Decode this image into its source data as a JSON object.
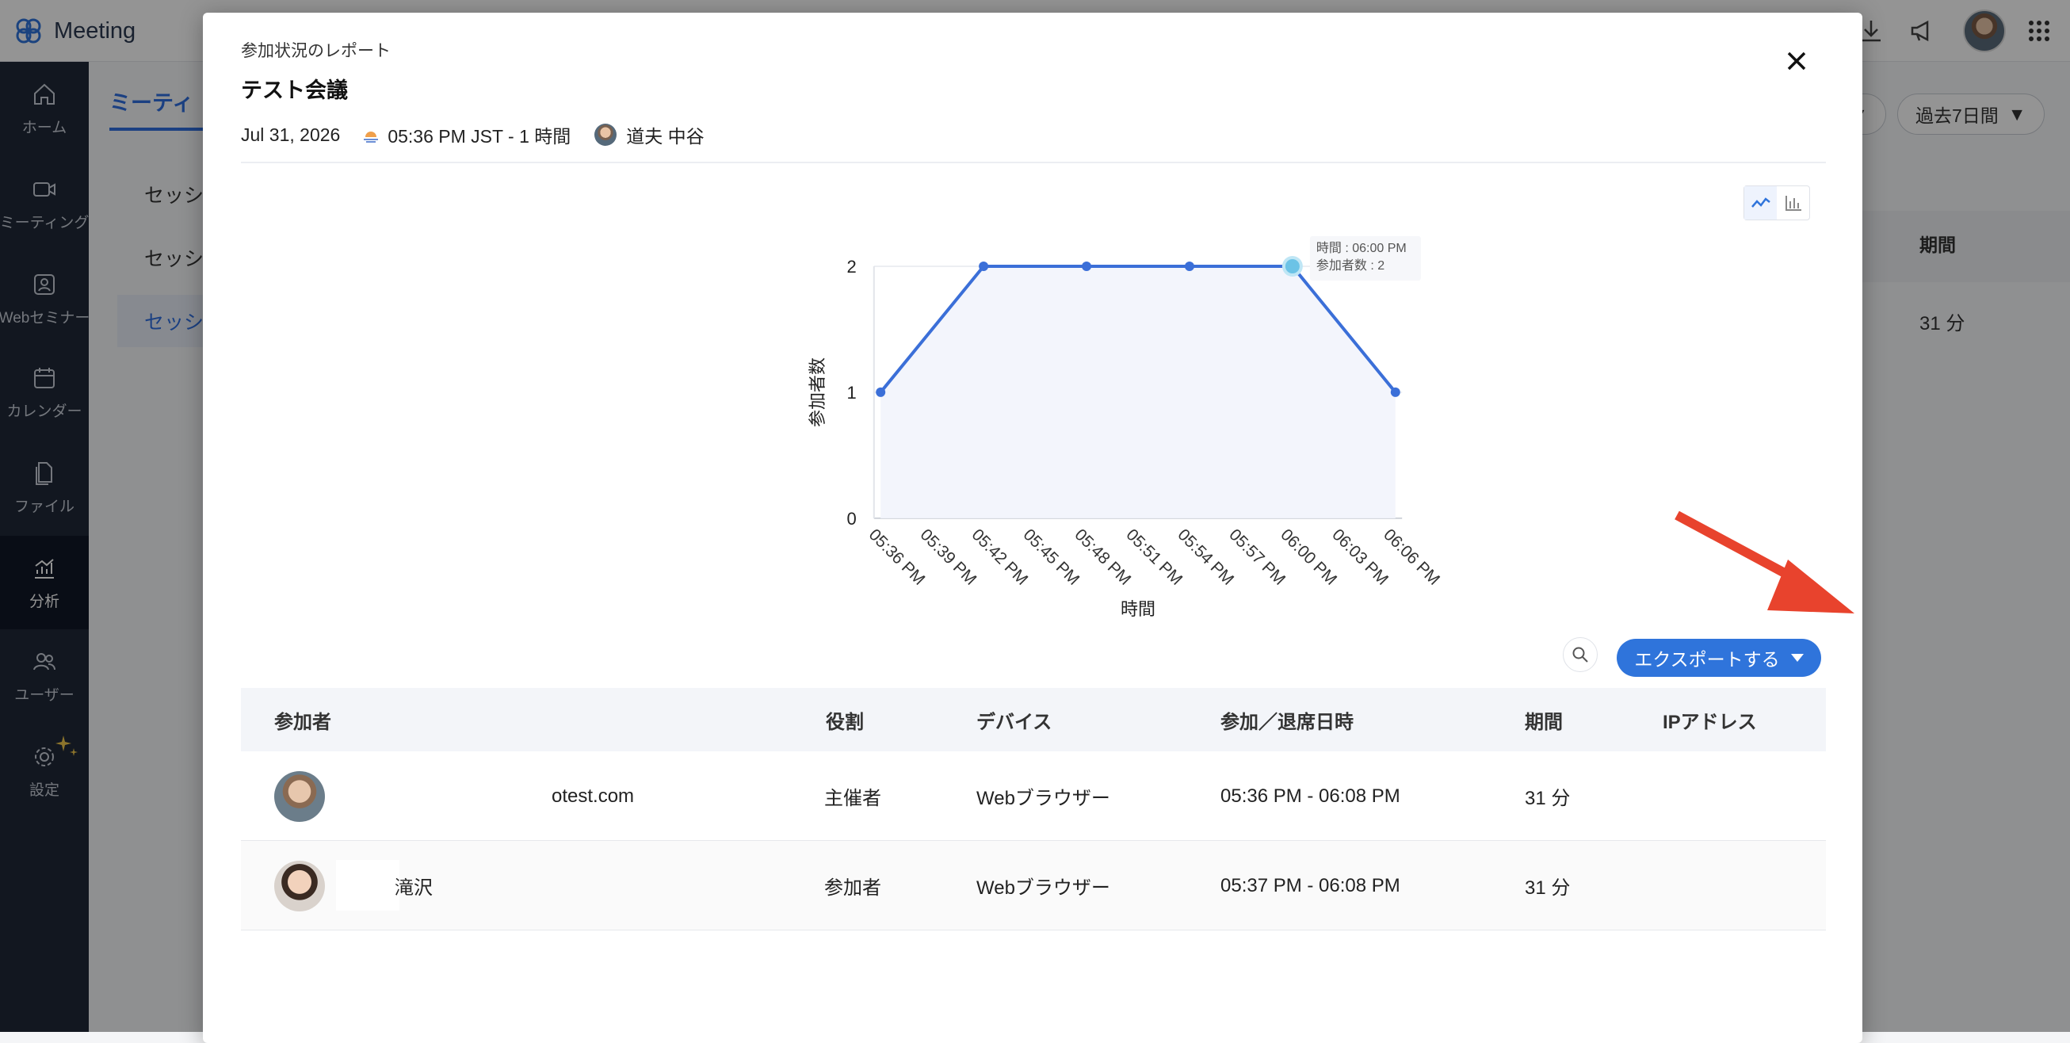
{
  "app": {
    "name": "Meeting"
  },
  "sidebar": {
    "items": [
      {
        "label": "ホーム",
        "icon": "home-icon"
      },
      {
        "label": "ミーティング",
        "icon": "video-icon"
      },
      {
        "label": "Webセミナー",
        "icon": "webinar-icon"
      },
      {
        "label": "カレンダー",
        "icon": "calendar-icon"
      },
      {
        "label": "ファイル",
        "icon": "file-icon"
      },
      {
        "label": "分析",
        "icon": "analytics-icon"
      },
      {
        "label": "ユーザー",
        "icon": "users-icon"
      },
      {
        "label": "設定",
        "icon": "gear-icon"
      }
    ]
  },
  "background": {
    "tab": "ミーティ",
    "list": [
      "セッシ",
      "セッシ",
      "セッシ"
    ],
    "period_filter": "過去7日間",
    "column_header": "期間",
    "cell_value": "31 分"
  },
  "modal": {
    "subtitle": "参加状況のレポート",
    "title": "テスト会議",
    "date": "Jul 31, 2026",
    "time": "05:36 PM JST - 1 時間",
    "host": "道夫 中谷",
    "export_label": "エクスポートする",
    "table": {
      "headers": {
        "participant": "参加者",
        "role": "役割",
        "device": "デバイス",
        "joined_left": "参加／退席日時",
        "duration": "期間",
        "ip": "IPアドレス"
      },
      "rows": [
        {
          "name": "",
          "email_fragment": "otest.com",
          "role": "主催者",
          "device": "Webブラウザー",
          "time": "05:36 PM - 06:08 PM",
          "duration": "31 分"
        },
        {
          "name": "滝沢",
          "email_fragment": "",
          "role": "参加者",
          "device": "Webブラウザー",
          "time": "05:37 PM - 06:08 PM",
          "duration": "31 分"
        }
      ]
    }
  },
  "chart_data": {
    "type": "area",
    "x": [
      "05:36 PM",
      "05:39 PM",
      "05:42 PM",
      "05:45 PM",
      "05:48 PM",
      "05:51 PM",
      "05:54 PM",
      "05:57 PM",
      "06:00 PM",
      "06:03 PM",
      "06:06 PM"
    ],
    "points": [
      {
        "x": "05:36 PM",
        "y": 1
      },
      {
        "x": "05:42 PM",
        "y": 2
      },
      {
        "x": "05:48 PM",
        "y": 2
      },
      {
        "x": "05:54 PM",
        "y": 2
      },
      {
        "x": "06:00 PM",
        "y": 2
      },
      {
        "x": "06:06 PM",
        "y": 1
      }
    ],
    "xlabel": "時間",
    "ylabel": "参加者数",
    "yticks": [
      0,
      1,
      2
    ],
    "ylim": [
      0,
      2
    ],
    "color": "#3b6fd8",
    "tooltip": {
      "line1": "時間 : 06:00 PM",
      "line2": "参加者数 : 2"
    }
  }
}
